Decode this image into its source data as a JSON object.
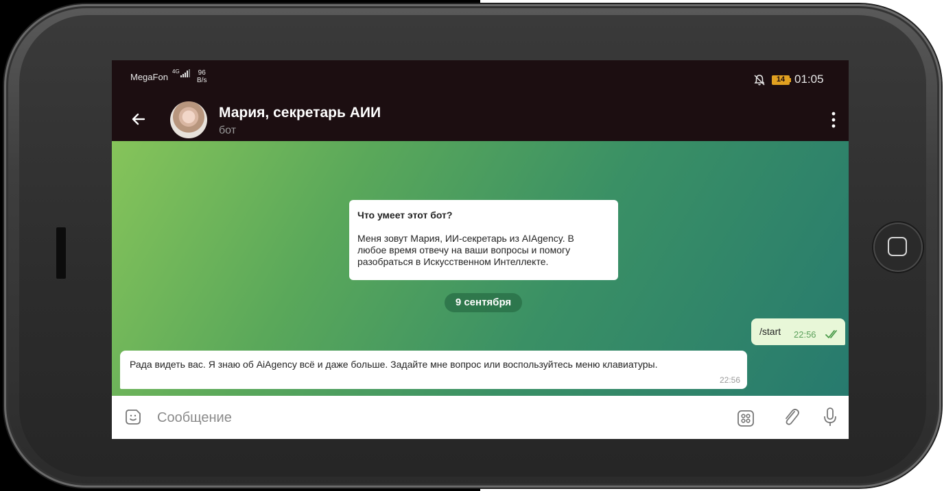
{
  "status_bar": {
    "carrier": "MegaFon",
    "network": "4G",
    "speed_value": "96",
    "speed_unit": "B/s",
    "battery": "14",
    "time": "01:05"
  },
  "header": {
    "title": "Мария, секретарь АИИ",
    "subtitle": "бот"
  },
  "bot_info": {
    "title": "Что умеет этот бот?",
    "text": "Меня зовут Мария, ИИ-секретарь из AIAgency. В\nлюбое время отвечу на ваши вопросы  и помогу\nразобраться в Искусственном Интеллекте."
  },
  "date_separator": "9 сентября",
  "messages": [
    {
      "direction": "out",
      "text": "/start",
      "time": "22:56",
      "status": "read"
    },
    {
      "direction": "in",
      "text": "Рада видеть вас. Я знаю об AiAgency всё и даже больше. Задайте мне вопрос или воспользуйтесь меню клавиатуры.",
      "time": "22:56"
    }
  ],
  "input": {
    "placeholder": "Сообщение"
  },
  "colors": {
    "app_bar": "#1c0e11",
    "chat_gradient_start": "#86c45a",
    "chat_gradient_end": "#277a6e",
    "outgoing_bubble": "#e8f7d8",
    "battery": "#e0a020"
  },
  "icons": [
    "back-arrow-icon",
    "more-vertical-icon",
    "bell-off-icon",
    "sticker-icon",
    "keyboard-icon",
    "attach-icon",
    "mic-icon",
    "double-check-icon"
  ]
}
